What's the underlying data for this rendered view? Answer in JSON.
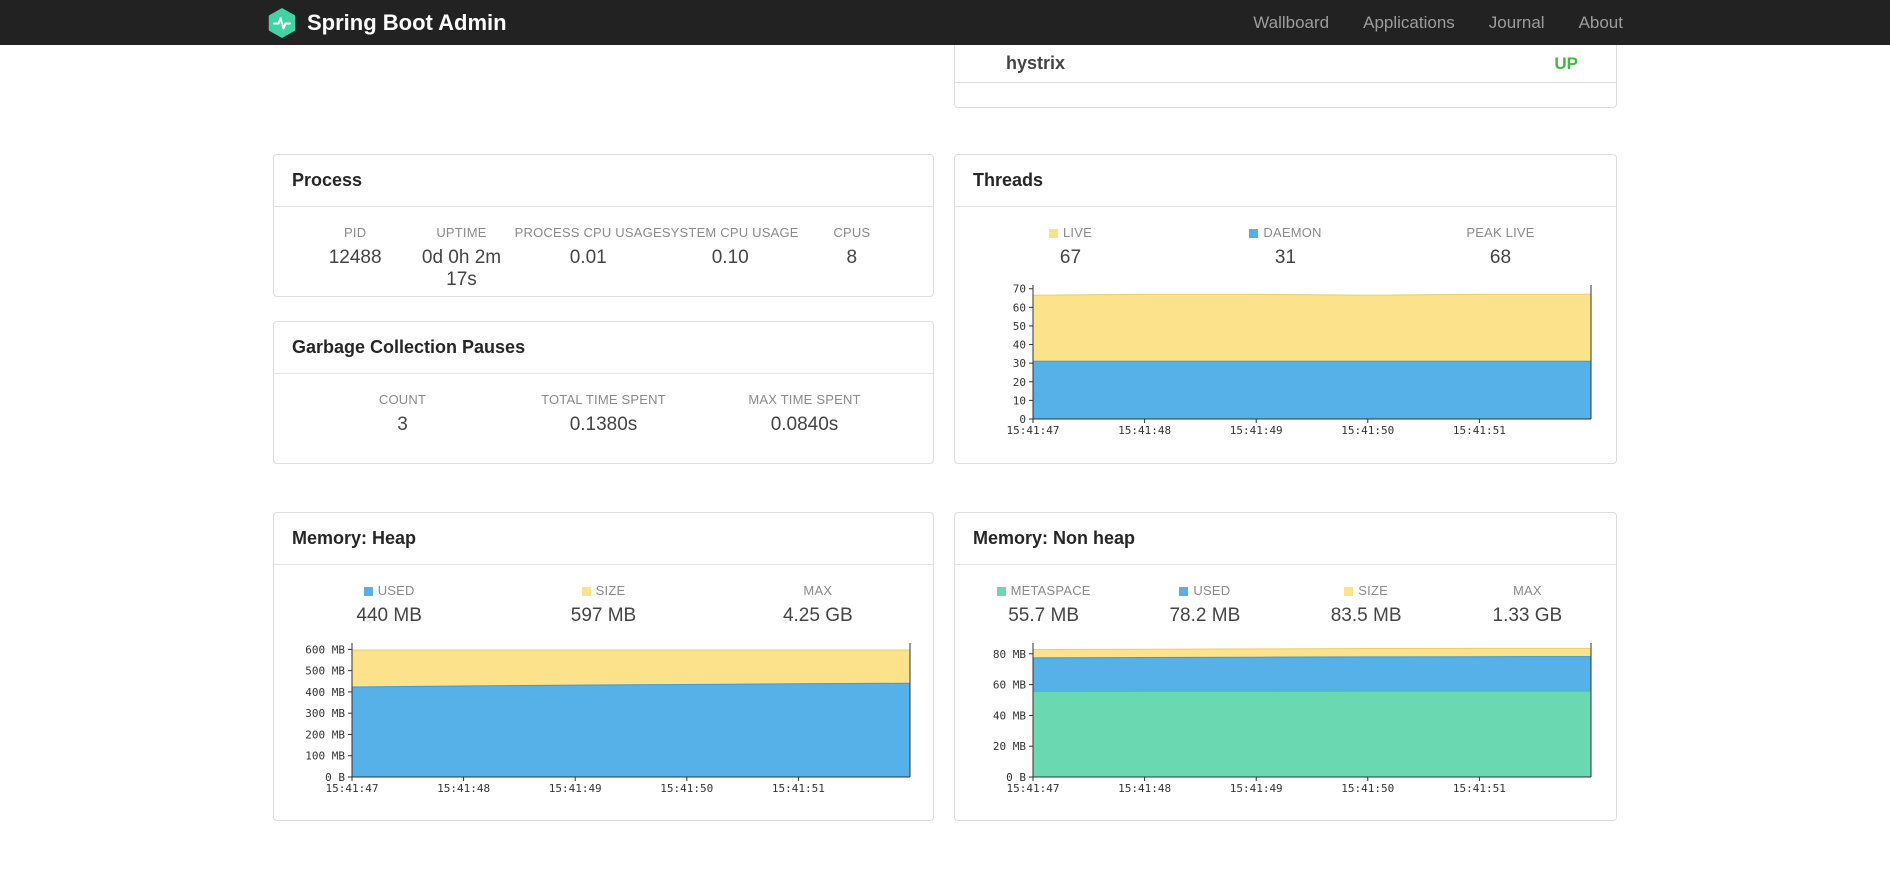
{
  "navbar": {
    "brand": "Spring Boot Admin",
    "items": [
      {
        "label": "Wallboard"
      },
      {
        "label": "Applications"
      },
      {
        "label": "Journal"
      },
      {
        "label": "About"
      }
    ]
  },
  "colors": {
    "brand_green": "#42d3a4",
    "status_up": "#3eba3e",
    "series_yellow": "#fbe28b",
    "series_blue": "#55b1e8",
    "series_green": "#6ad9b2"
  },
  "applications": {
    "rows": [
      {
        "name": "hystrix",
        "status": "UP"
      }
    ]
  },
  "process": {
    "title": "Process",
    "stats": [
      {
        "label": "PID",
        "value": "12488"
      },
      {
        "label": "UPTIME",
        "value": "0d 0h 2m 17s"
      },
      {
        "label": "PROCESS CPU USAGE",
        "value": "0.01"
      },
      {
        "label": "SYSTEM CPU USAGE",
        "value": "0.10"
      },
      {
        "label": "CPUS",
        "value": "8"
      }
    ]
  },
  "gc": {
    "title": "Garbage Collection Pauses",
    "stats": [
      {
        "label": "COUNT",
        "value": "3"
      },
      {
        "label": "TOTAL TIME SPENT",
        "value": "0.1380s"
      },
      {
        "label": "MAX TIME SPENT",
        "value": "0.0840s"
      }
    ]
  },
  "threads": {
    "title": "Threads",
    "legend": [
      {
        "label": "LIVE",
        "value": "67",
        "color": "#fbe28b"
      },
      {
        "label": "DAEMON",
        "value": "31",
        "color": "#55b1e8"
      },
      {
        "label": "PEAK LIVE",
        "value": "68"
      }
    ]
  },
  "memory_heap": {
    "title": "Memory: Heap",
    "legend": [
      {
        "label": "USED",
        "value": "440 MB",
        "color": "#55b1e8"
      },
      {
        "label": "SIZE",
        "value": "597 MB",
        "color": "#fbe28b"
      },
      {
        "label": "MAX",
        "value": "4.25 GB"
      }
    ]
  },
  "memory_nonheap": {
    "title": "Memory: Non heap",
    "legend": [
      {
        "label": "METASPACE",
        "value": "55.7 MB",
        "color": "#6ad9b2"
      },
      {
        "label": "USED",
        "value": "78.2 MB",
        "color": "#55b1e8"
      },
      {
        "label": "SIZE",
        "value": "83.5 MB",
        "color": "#fbe28b"
      },
      {
        "label": "MAX",
        "value": "1.33 GB"
      }
    ]
  },
  "chart_data": [
    {
      "id": "threads",
      "type": "area",
      "title": "Threads",
      "ylim": [
        0,
        72
      ],
      "legend_position": "top",
      "grid": false,
      "y_ticks": [
        {
          "value": 0,
          "label": "0"
        },
        {
          "value": 10,
          "label": "10"
        },
        {
          "value": 20,
          "label": "20"
        },
        {
          "value": 30,
          "label": "30"
        },
        {
          "value": 40,
          "label": "40"
        },
        {
          "value": 50,
          "label": "50"
        },
        {
          "value": 60,
          "label": "60"
        },
        {
          "value": 70,
          "label": "70"
        }
      ],
      "x_labels": [
        "15:41:47",
        "15:41:48",
        "15:41:49",
        "15:41:50",
        "15:41:51"
      ],
      "series": [
        {
          "name": "LIVE",
          "color": "#fbe28b",
          "stroke": "#e9cf6d",
          "values": [
            66.5,
            67,
            67,
            66.5,
            67,
            67
          ]
        },
        {
          "name": "DAEMON",
          "color": "#55b1e8",
          "stroke": "#3d9bd5",
          "values": [
            31,
            31,
            31,
            31,
            31,
            31
          ]
        }
      ]
    },
    {
      "id": "heap",
      "type": "area",
      "title": "Memory: Heap",
      "unit": "MB",
      "ylim": [
        0,
        630
      ],
      "legend_position": "top",
      "grid": false,
      "y_ticks": [
        {
          "value": 0,
          "label": "0 B"
        },
        {
          "value": 100,
          "label": "100 MB"
        },
        {
          "value": 200,
          "label": "200 MB"
        },
        {
          "value": 300,
          "label": "300 MB"
        },
        {
          "value": 400,
          "label": "400 MB"
        },
        {
          "value": 500,
          "label": "500 MB"
        },
        {
          "value": 600,
          "label": "600 MB"
        }
      ],
      "x_labels": [
        "15:41:47",
        "15:41:48",
        "15:41:49",
        "15:41:50",
        "15:41:51"
      ],
      "series": [
        {
          "name": "SIZE",
          "color": "#fbe28b",
          "stroke": "#e9cf6d",
          "values": [
            597,
            597,
            597,
            597,
            597,
            597
          ]
        },
        {
          "name": "USED",
          "color": "#55b1e8",
          "stroke": "#3d9bd5",
          "values": [
            423,
            428,
            432,
            435,
            438,
            441
          ]
        }
      ]
    },
    {
      "id": "nonheap",
      "type": "area",
      "title": "Memory: Non heap",
      "unit": "MB",
      "ylim": [
        0,
        87
      ],
      "legend_position": "top",
      "grid": false,
      "y_ticks": [
        {
          "value": 0,
          "label": "0 B"
        },
        {
          "value": 20,
          "label": "20 MB"
        },
        {
          "value": 40,
          "label": "40 MB"
        },
        {
          "value": 60,
          "label": "60 MB"
        },
        {
          "value": 80,
          "label": "80 MB"
        }
      ],
      "x_labels": [
        "15:41:47",
        "15:41:48",
        "15:41:49",
        "15:41:50",
        "15:41:51"
      ],
      "series": [
        {
          "name": "SIZE",
          "color": "#fbe28b",
          "stroke": "#e9cf6d",
          "values": [
            82.8,
            83,
            83.2,
            83.4,
            83.5,
            83.5
          ]
        },
        {
          "name": "USED",
          "color": "#55b1e8",
          "stroke": "#3d9bd5",
          "values": [
            77.3,
            77.6,
            77.8,
            78,
            78.1,
            78.2
          ]
        },
        {
          "name": "METASPACE",
          "color": "#6ad9b2",
          "stroke": "#45c79b",
          "values": [
            55.5,
            55.6,
            55.6,
            55.7,
            55.7,
            55.7
          ]
        }
      ]
    }
  ]
}
